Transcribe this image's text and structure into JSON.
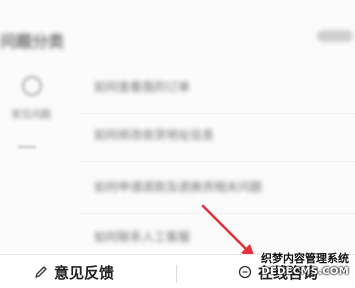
{
  "header": {
    "title": "问题分类",
    "action_icon": "more-icon"
  },
  "sidebar": {
    "category_icon": "circle-icon",
    "category_label": "常见问题",
    "more_icon": "dash-icon"
  },
  "faq": {
    "items": [
      "如何查看我的订单",
      "如何修改收货地址信息",
      "如何申请退款及退换货相关问题",
      "如何联系人工客服"
    ]
  },
  "bottom_bar": {
    "feedback_label": "意见反馈",
    "feedback_icon": "pencil-icon",
    "online_label": "在线咨询",
    "online_icon": "chat-icon"
  },
  "annotation": {
    "arrow_color": "#e0343a"
  },
  "watermark": {
    "line1": "织梦内容管理系统",
    "line2": "DEDECMS.COM"
  }
}
